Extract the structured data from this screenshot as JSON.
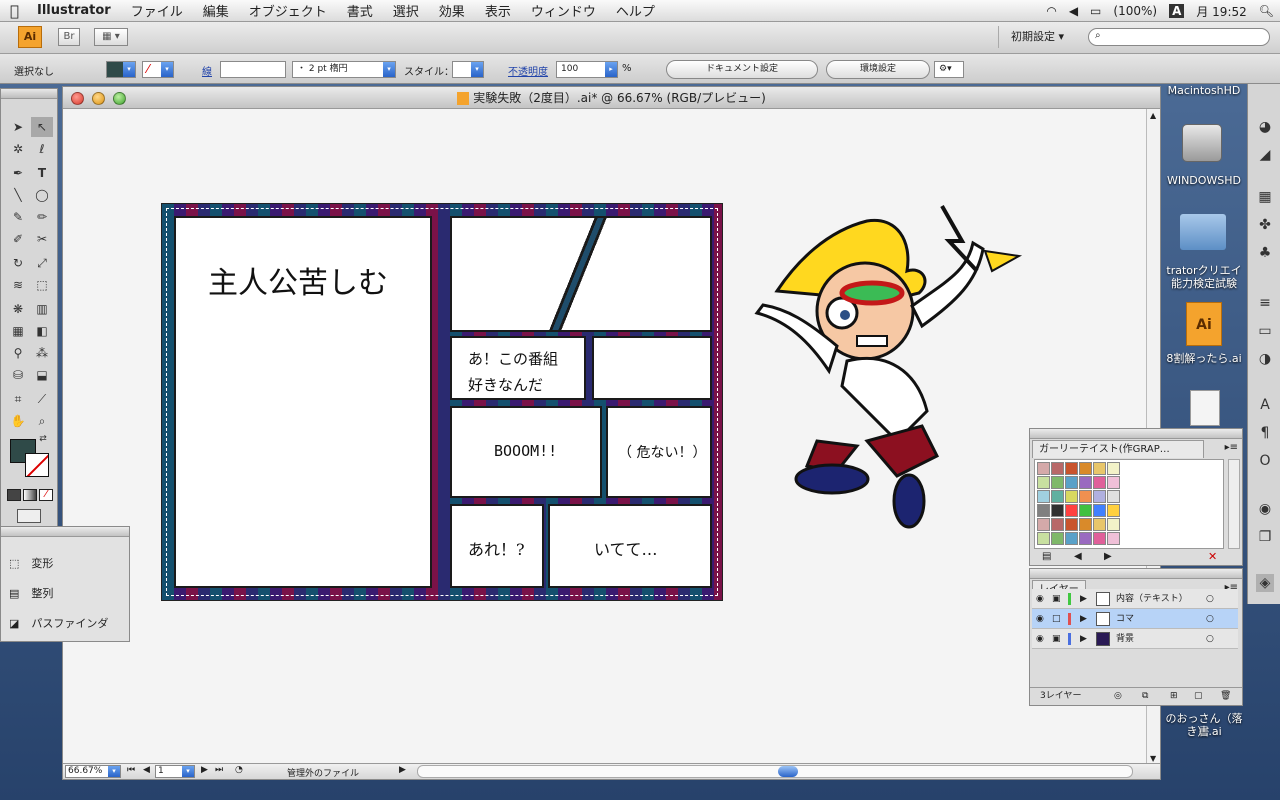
{
  "menubar": {
    "apple": "",
    "app": "Illustrator",
    "items": [
      "ファイル",
      "編集",
      "オブジェクト",
      "書式",
      "選択",
      "効果",
      "表示",
      "ウィンドウ",
      "ヘルプ"
    ],
    "battery": "(100%)",
    "input": "A",
    "clock": "月 19:52"
  },
  "appbar": {
    "ai": "Ai",
    "br": "Br",
    "workspace": "初期設定 ▾"
  },
  "control": {
    "selection": "選択なし",
    "stroke_label": "線",
    "stroke_weight": "",
    "brush": "・ 2 pt 楕円",
    "style_label": "スタイル：",
    "opacity_label": "不透明度",
    "opacity": "100",
    "percent": "%",
    "doc_settings": "ドキュメント設定",
    "prefs": "環境設定"
  },
  "document": {
    "title": "実験失敗（2度目）.ai* @ 66.67% (RGB/プレビュー)"
  },
  "status": {
    "zoom": "66.67%",
    "page": "1",
    "info": "管理外のファイル"
  },
  "comic": {
    "panel1": "主人公苦しむ",
    "panel3a": "あ！この番組",
    "panel3b": "好きなんだ",
    "panel5": "BOOOM!!",
    "panel6": "（ 危ない！）",
    "panel7": "あれ！?",
    "panel8": "いてて…"
  },
  "desktop": {
    "hd1": "MacintoshHD",
    "hd2": "WINDOWSHD",
    "folder1": "tratorクリエイ",
    "folder2": "能力検定試験",
    "ai_file": "8割解ったら.ai",
    "file_b1": "のおっさん（落書",
    "file_b2": "き）.ai",
    "ai_icon": "Ai"
  },
  "swatches": {
    "title": "ガーリーテイスト(作GRAP…"
  },
  "layers": {
    "tab": "レイヤー",
    "rows": [
      {
        "name": "内容（テキスト）"
      },
      {
        "name": "コマ"
      },
      {
        "name": "背景"
      }
    ],
    "count": "3レイヤー"
  },
  "transform": {
    "items": [
      "変形",
      "整列",
      "パスファインダ"
    ]
  },
  "colors": {
    "menubar": "#e5e5e5",
    "accent": "#2a64c9",
    "selected_layer": "#b7d3f7"
  }
}
